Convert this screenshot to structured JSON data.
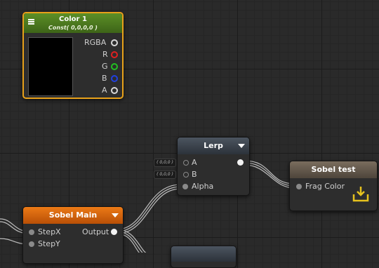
{
  "nodes": {
    "color": {
      "title": "Color 1",
      "subtitle": "Const( 0,0,0,0 )",
      "ports": {
        "rgba": "RGBA",
        "r": "R",
        "g": "G",
        "b": "B",
        "a": "A"
      },
      "header_color": "#4d7a1e",
      "border_color": "#e8a11a"
    },
    "lerp": {
      "title": "Lerp",
      "ports": {
        "a": "A",
        "b": "B",
        "alpha": "Alpha"
      },
      "defaults": {
        "a": "( 0,0,0 )",
        "b": "( 0,0,0 )"
      }
    },
    "sobel_test": {
      "title": "Sobel test",
      "ports": {
        "frag_color": "Frag Color"
      }
    },
    "sobel_main": {
      "title": "Sobel Main",
      "ports": {
        "stepx": "StepX",
        "stepy": "StepY",
        "output": "Output"
      },
      "header_color": "#e06c10"
    }
  },
  "colors": {
    "canvas": "#2a2a2a",
    "pin_r": "#e02020",
    "pin_g": "#22c022",
    "pin_b": "#2040e0",
    "save_icon": "#e6c21e"
  }
}
